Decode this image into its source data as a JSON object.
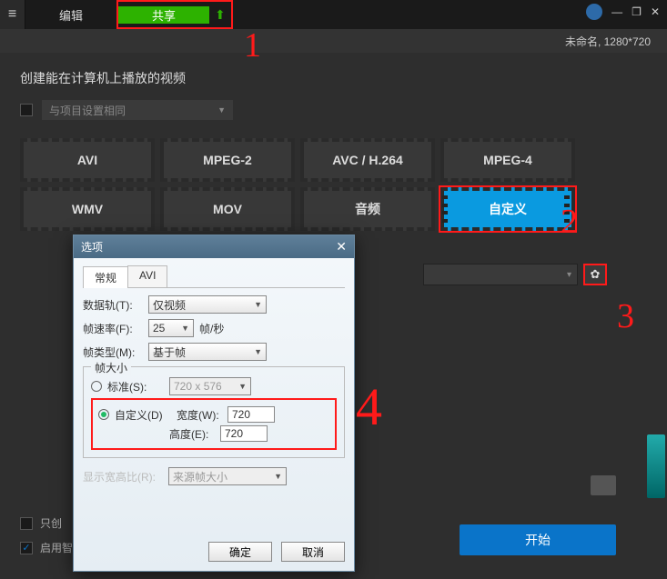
{
  "topbar": {
    "edit_tab": "编辑",
    "share_tab": "共享"
  },
  "window_controls": {
    "minimize": "—",
    "restore": "❐",
    "close": "✕"
  },
  "title_strip": "未命名, 1280*720",
  "main": {
    "heading": "创建能在计算机上播放的视频",
    "project_same_label": "与项目设置相同",
    "formats": [
      "AVI",
      "MPEG-2",
      "AVC / H.264",
      "MPEG-4",
      "WMV",
      "MOV",
      "音频",
      "自定义"
    ]
  },
  "annotations": {
    "n1": "1",
    "n2": "2",
    "n3": "3",
    "n4": "4"
  },
  "bottom": {
    "only_create": "只创",
    "enable_smart": "启用智能渲染",
    "start": "开始"
  },
  "path_select_caret": "▾",
  "gear_glyph": "✿",
  "dialog": {
    "title": "选项",
    "close": "✕",
    "tabs": {
      "general": "常规",
      "avi": "AVI"
    },
    "track_label": "数据轨(T):",
    "track_value": "仅视频",
    "fps_label": "帧速率(F):",
    "fps_value": "25",
    "fps_unit": "帧/秒",
    "frametype_label": "帧类型(M):",
    "frametype_value": "基于帧",
    "framesize_legend": "帧大小",
    "standard_label": "标准(S):",
    "standard_value": "720 x 576",
    "custom_label": "自定义(D)",
    "width_label": "宽度(W):",
    "width_value": "720",
    "height_label": "高度(E):",
    "height_value": "720",
    "aspect_label": "显示宽高比(R):",
    "aspect_value": "来源帧大小",
    "ok": "确定",
    "cancel": "取消"
  }
}
